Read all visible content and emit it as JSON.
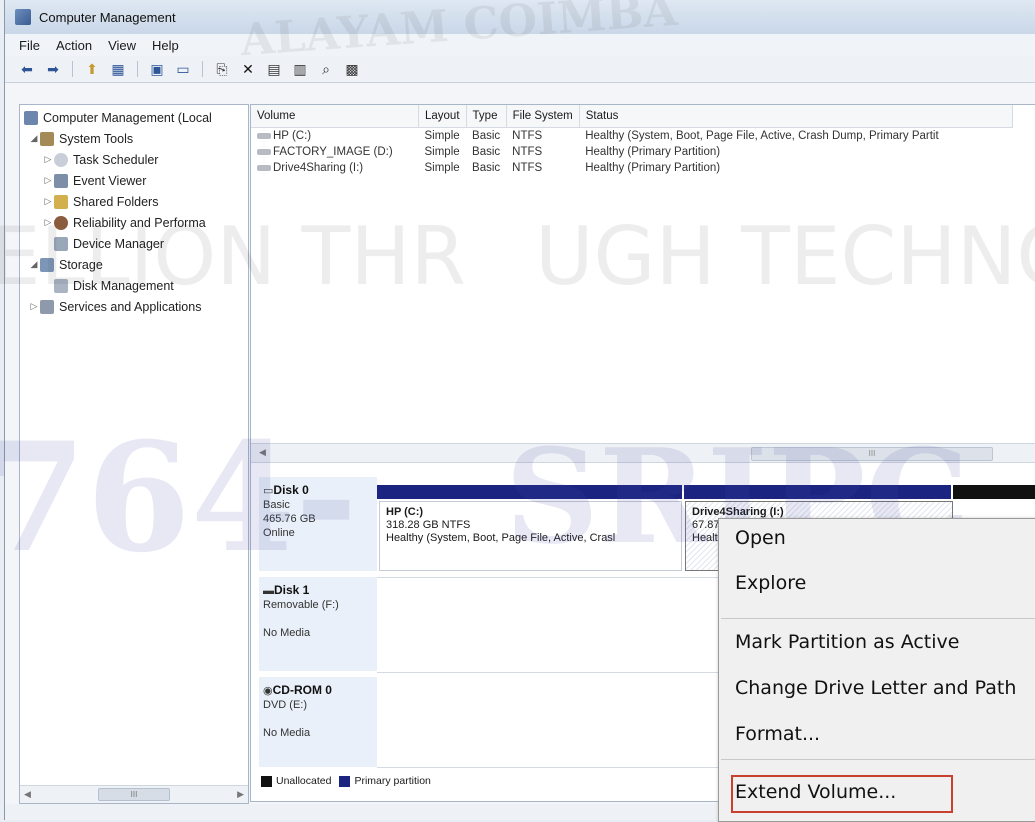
{
  "window": {
    "title": "Computer Management"
  },
  "menu": [
    "File",
    "Action",
    "View",
    "Help"
  ],
  "toolbar": {
    "icons": [
      "back-arrow-icon",
      "forward-arrow-icon",
      "up-folder-icon",
      "show-tree-icon",
      "properties-icon",
      "help-icon",
      "export-icon",
      "delete-icon",
      "disk-icon",
      "folder-icon",
      "search-icon",
      "properties2-icon"
    ]
  },
  "tree": [
    {
      "label": "Computer Management (Local",
      "level": 0,
      "arrow": ""
    },
    {
      "label": "System Tools",
      "level": 1,
      "arrow": "◢"
    },
    {
      "label": "Task Scheduler",
      "level": 2,
      "arrow": "▷"
    },
    {
      "label": "Event Viewer",
      "level": 2,
      "arrow": "▷"
    },
    {
      "label": "Shared Folders",
      "level": 2,
      "arrow": "▷"
    },
    {
      "label": "Reliability and Performa",
      "level": 2,
      "arrow": "▷"
    },
    {
      "label": "Device Manager",
      "level": 2,
      "arrow": ""
    },
    {
      "label": "Storage",
      "level": 1,
      "arrow": "◢"
    },
    {
      "label": "Disk Management",
      "level": 2,
      "arrow": ""
    },
    {
      "label": "Services and Applications",
      "level": 1,
      "arrow": "▷"
    }
  ],
  "volumes": {
    "headers": [
      "Volume",
      "Layout",
      "Type",
      "File System",
      "Status"
    ],
    "rows": [
      [
        "HP (C:)",
        "Simple",
        "Basic",
        "NTFS",
        "Healthy (System, Boot, Page File, Active, Crash Dump, Primary Partit"
      ],
      [
        "FACTORY_IMAGE (D:)",
        "Simple",
        "Basic",
        "NTFS",
        "Healthy (Primary Partition)"
      ],
      [
        "Drive4Sharing (I:)",
        "Simple",
        "Basic",
        "NTFS",
        "Healthy (Primary Partition)"
      ]
    ]
  },
  "hscroll_thumb": "III",
  "disks": [
    {
      "name": "Disk 0",
      "l1": "Basic",
      "l2": "465.76 GB",
      "l3": "Online"
    },
    {
      "name": "Disk 1",
      "l1": "Removable (F:)",
      "l2": "",
      "l3": "No Media"
    },
    {
      "name": "CD-ROM 0",
      "l1": "DVD (E:)",
      "l2": "",
      "l3": "No Media"
    }
  ],
  "partitions": {
    "hp": {
      "name": "HP (C:)",
      "size": "318.28 GB NTFS",
      "status": "Healthy (System, Boot, Page File, Active, Crasl"
    },
    "drive4": {
      "name": "Drive4Sharing (I:)",
      "size": "67.87",
      "status": "Healt"
    }
  },
  "legend": {
    "unallocated": "Unallocated",
    "primary": "Primary partition"
  },
  "context_menu": [
    "Open",
    "Explore",
    "Mark Partition as Active",
    "Change Drive Letter and Path",
    "Format...",
    "Extend Volume..."
  ],
  "watermark": {
    "top": "ALAYAM COIMBA",
    "middle": "ELLION THR",
    "middle2": "UGH TECHNOLO",
    "bottom1": "764-",
    "bottom2": "SRIPC"
  },
  "colors": {
    "primary_partition": "#1c2482",
    "unallocated": "#111111",
    "highlight": "#c9412c"
  }
}
